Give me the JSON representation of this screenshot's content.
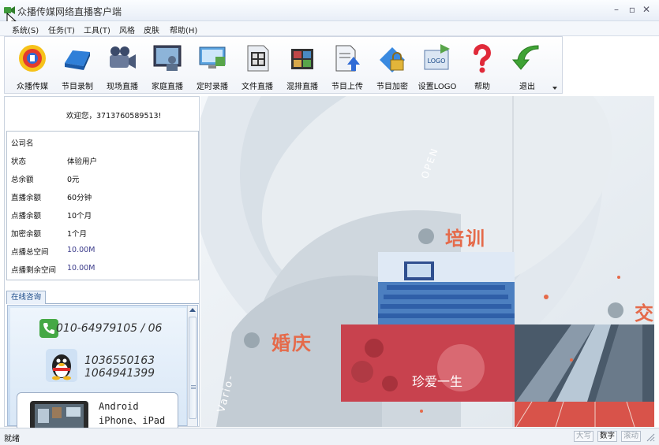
{
  "window": {
    "title": "众播传媒网络直播客户端",
    "minimize": "–",
    "maximize": "▫",
    "close": "✕"
  },
  "menu": [
    "系统(S)",
    "任务(T)",
    "工具(T)",
    "风格",
    "皮肤",
    "帮助(H)"
  ],
  "toolbar": [
    {
      "label": "众播传媒",
      "icon": "broadcast-logo-icon"
    },
    {
      "label": "节目录制",
      "icon": "hard-drive-icon"
    },
    {
      "label": "现场直播",
      "icon": "video-camera-icon"
    },
    {
      "label": "家庭直播",
      "icon": "home-presenter-icon"
    },
    {
      "label": "定时录播",
      "icon": "scheduled-record-icon"
    },
    {
      "label": "文件直播",
      "icon": "film-file-icon"
    },
    {
      "label": "混排直播",
      "icon": "mixed-film-icon"
    },
    {
      "label": "节目上传",
      "icon": "upload-icon"
    },
    {
      "label": "节目加密",
      "icon": "lock-icon"
    },
    {
      "label": "设置LOGO",
      "icon": "logo-setting-icon"
    },
    {
      "label": "帮助",
      "icon": "question-icon"
    },
    {
      "label": "退出",
      "icon": "exit-arrow-icon"
    }
  ],
  "account": {
    "welcome": "欢迎您，3713760589513!",
    "rows": [
      {
        "label": "公司名",
        "value": ""
      },
      {
        "label": "状态",
        "value": "体验用户"
      },
      {
        "label": "总余额",
        "value": "0元"
      },
      {
        "label": "直播余额",
        "value": "60分钟"
      },
      {
        "label": "点播余额",
        "value": "10个月"
      },
      {
        "label": "加密余额",
        "value": "1个月"
      },
      {
        "label": "点播总空间",
        "value": "10.00M"
      },
      {
        "label": "点播剩余空间",
        "value": "10.00M"
      }
    ]
  },
  "consult": {
    "tab": "在线咨询",
    "phone": "010-64979105 / 06",
    "qq1": "1036550163",
    "qq2": "1064941399",
    "device1": "Android",
    "device2": "iPhone、iPad"
  },
  "banner": {
    "label1": "培训",
    "label2": "婚庆",
    "label3": "交",
    "lens_text1": "OPEN",
    "lens_text2": "Vario-"
  },
  "status": {
    "text": "就绪",
    "caps": "大写",
    "num": "数字",
    "scroll": "滚动"
  },
  "colors": {
    "accent": "#1a4a88",
    "banner_text": "#e56a4a",
    "value_blue": "#3a3a8a"
  }
}
